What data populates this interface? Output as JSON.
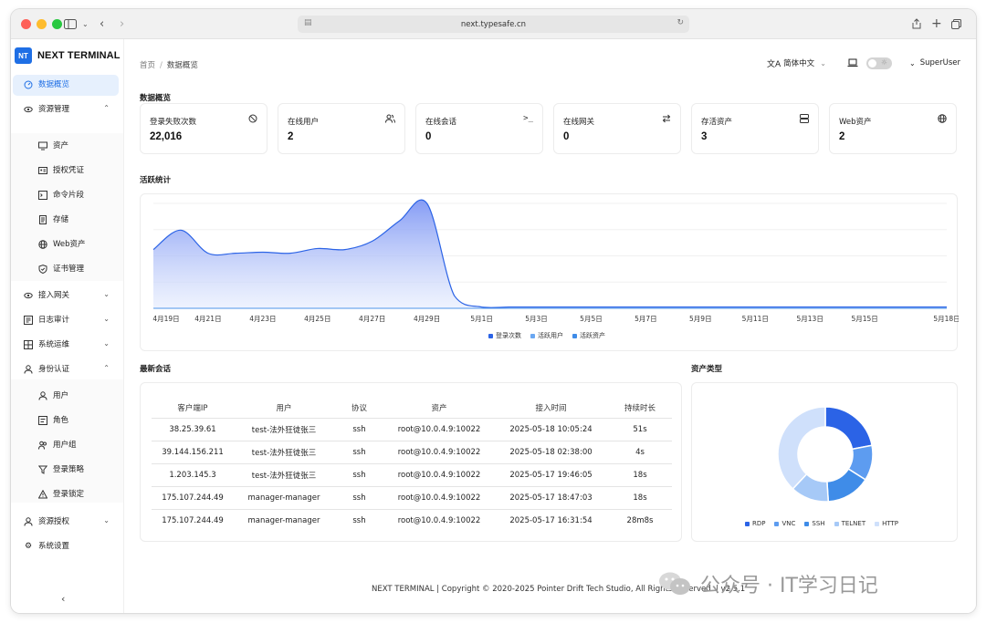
{
  "browser": {
    "url": "next.typesafe.cn"
  },
  "brand": {
    "logo": "NT",
    "name": "NEXT TERMINAL"
  },
  "sidebar": {
    "items": [
      {
        "label": "数据概览",
        "icon": "dashboard-icon",
        "active": true
      },
      {
        "label": "资源管理",
        "icon": "resource-icon",
        "expanded": true
      },
      {
        "label": "资产",
        "icon": "monitor-icon",
        "sub": true
      },
      {
        "label": "授权凭证",
        "icon": "credential-icon",
        "sub": true
      },
      {
        "label": "命令片段",
        "icon": "terminal-icon",
        "sub": true
      },
      {
        "label": "存储",
        "icon": "storage-icon",
        "sub": true
      },
      {
        "label": "Web资产",
        "icon": "globe-icon",
        "sub": true
      },
      {
        "label": "证书管理",
        "icon": "shield-icon",
        "sub": true
      },
      {
        "label": "接入网关",
        "icon": "gateway-icon",
        "expanded": false
      },
      {
        "label": "日志审计",
        "icon": "log-icon",
        "expanded": false
      },
      {
        "label": "系统运维",
        "icon": "ops-icon",
        "expanded": false
      },
      {
        "label": "身份认证",
        "icon": "user-icon",
        "expanded": true
      },
      {
        "label": "用户",
        "icon": "user-icon",
        "sub": true
      },
      {
        "label": "角色",
        "icon": "role-icon",
        "sub": true
      },
      {
        "label": "用户组",
        "icon": "group-icon",
        "sub": true
      },
      {
        "label": "登录策略",
        "icon": "filter-icon",
        "sub": true
      },
      {
        "label": "登录锁定",
        "icon": "warning-icon",
        "sub": true
      },
      {
        "label": "资源授权",
        "icon": "user-icon",
        "expanded": false
      },
      {
        "label": "系统设置",
        "icon": "gear-icon"
      }
    ]
  },
  "header": {
    "breadcrumb": [
      "首页",
      "数据概览"
    ],
    "language": "简体中文",
    "user": "SuperUser"
  },
  "overview": {
    "title": "数据概览",
    "cards": [
      {
        "title": "登录失败次数",
        "value": "22,016",
        "icon": "block-icon"
      },
      {
        "title": "在线用户",
        "value": "2",
        "icon": "users-icon"
      },
      {
        "title": "在线会话",
        "value": "0",
        "icon": "terminal-icon"
      },
      {
        "title": "在线网关",
        "value": "0",
        "icon": "swap-icon"
      },
      {
        "title": "存活资产",
        "value": "3",
        "icon": "server-icon"
      },
      {
        "title": "Web资产",
        "value": "2",
        "icon": "globe-icon"
      }
    ]
  },
  "activity": {
    "title": "活跃统计"
  },
  "sessions": {
    "title": "最新会话",
    "columns": [
      "客户端IP",
      "用户",
      "协议",
      "资产",
      "接入时间",
      "持续时长"
    ],
    "rows": [
      [
        "38.25.39.61",
        "test-法外狂徒张三",
        "ssh",
        "root@10.0.4.9:10022",
        "2025-05-18 10:05:24",
        "51s"
      ],
      [
        "39.144.156.211",
        "test-法外狂徒张三",
        "ssh",
        "root@10.0.4.9:10022",
        "2025-05-18 02:38:00",
        "4s"
      ],
      [
        "1.203.145.3",
        "test-法外狂徒张三",
        "ssh",
        "root@10.0.4.9:10022",
        "2025-05-17 19:46:05",
        "18s"
      ],
      [
        "175.107.244.49",
        "manager-manager",
        "ssh",
        "root@10.0.4.9:10022",
        "2025-05-17 18:47:03",
        "18s"
      ],
      [
        "175.107.244.49",
        "manager-manager",
        "ssh",
        "root@10.0.4.9:10022",
        "2025-05-17 16:31:54",
        "28m8s"
      ]
    ]
  },
  "asset_types": {
    "title": "资产类型"
  },
  "footer": "NEXT TERMINAL | Copyright © 2020-2025 Pointer Drift Tech Studio, All Rights Reserved. | v2.5.1",
  "watermark": "公众号 · IT学习日记",
  "chart_data": [
    {
      "type": "area",
      "x": [
        "4月19日",
        "4月20日",
        "4月21日",
        "4月22日",
        "4月23日",
        "4月24日",
        "4月25日",
        "4月26日",
        "4月27日",
        "4月28日",
        "4月29日",
        "4月30日",
        "5月1日",
        "5月2日",
        "5月3日",
        "5月4日",
        "5月5日",
        "5月6日",
        "5月7日",
        "5月8日",
        "5月9日",
        "5月10日",
        "5月11日",
        "5月12日",
        "5月13日",
        "5月14日",
        "5月15日",
        "5月16日",
        "5月17日",
        "5月18日"
      ],
      "xticks": [
        "4月19日",
        "4月21日",
        "4月23日",
        "4月25日",
        "4月27日",
        "4月29日",
        "5月1日",
        "5月3日",
        "5月5日",
        "5月7日",
        "5月9日",
        "5月11日",
        "5月13日",
        "5月15日",
        "5月18日"
      ],
      "series": [
        {
          "name": "登录次数",
          "color": "#2b63e6",
          "values": [
            560,
            745,
            525,
            525,
            535,
            525,
            570,
            560,
            640,
            835,
            1000,
            120,
            12,
            12,
            12,
            12,
            12,
            12,
            12,
            12,
            12,
            12,
            12,
            12,
            12,
            12,
            12,
            12,
            12,
            12
          ]
        },
        {
          "name": "活跃用户",
          "color": "#6aa7f2",
          "values": [
            0,
            0,
            0,
            0,
            0,
            0,
            0,
            0,
            0,
            0,
            0,
            0,
            0,
            0,
            0,
            0,
            0,
            0,
            0,
            0,
            0,
            0,
            0,
            0,
            0,
            0,
            0,
            0,
            0,
            0
          ]
        },
        {
          "name": "活跃资产",
          "color": "#3f8ce8",
          "values": [
            0,
            0,
            0,
            0,
            0,
            0,
            0,
            0,
            0,
            0,
            0,
            0,
            0,
            0,
            0,
            0,
            0,
            0,
            0,
            0,
            0,
            0,
            0,
            0,
            0,
            0,
            0,
            0,
            0,
            0
          ]
        }
      ],
      "ylim": [
        0,
        1000
      ],
      "grid": true,
      "legend": "bottom"
    },
    {
      "type": "pie",
      "donut": true,
      "labels": [
        "RDP",
        "VNC",
        "SSH",
        "TELNET",
        "HTTP"
      ],
      "values": [
        22,
        12,
        15,
        13,
        38
      ],
      "colors": [
        "#2b63e6",
        "#5d9cf0",
        "#3f8ce8",
        "#a6c9f7",
        "#cfe0fb"
      ],
      "legend": "bottom"
    }
  ]
}
